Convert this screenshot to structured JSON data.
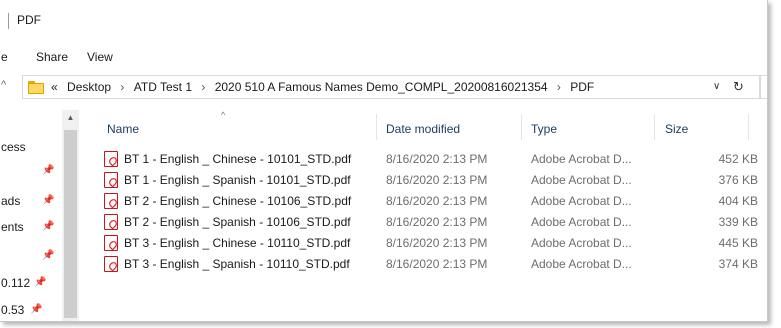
{
  "window": {
    "title": "PDF"
  },
  "ribbon": {
    "tabs": [
      "e",
      "Share",
      "View"
    ]
  },
  "address": {
    "crumbs": [
      "«",
      "Desktop",
      "ATD Test 1",
      "2020 510 A Famous Names Demo_COMPL_20200816021354",
      "PDF"
    ],
    "dropdown": "∨",
    "refresh": "↻"
  },
  "nav": {
    "items": [
      {
        "label": "cess",
        "pinned": false
      },
      {
        "label": "",
        "pinned": true
      },
      {
        "label": "ads",
        "pinned": true
      },
      {
        "label": "ents",
        "pinned": true
      },
      {
        "label": "",
        "pinned": true
      },
      {
        "label": "0.112",
        "pinned": true
      },
      {
        "label": "0.53",
        "pinned": true
      }
    ]
  },
  "columns": {
    "name": "Name",
    "date": "Date modified",
    "type": "Type",
    "size": "Size"
  },
  "files": [
    {
      "name": "BT 1 - English _ Chinese - 10101_STD.pdf",
      "date": "8/16/2020 2:13 PM",
      "type": "Adobe Acrobat D...",
      "size": "452 KB"
    },
    {
      "name": "BT 1 - English _ Spanish - 10101_STD.pdf",
      "date": "8/16/2020 2:13 PM",
      "type": "Adobe Acrobat D...",
      "size": "376 KB"
    },
    {
      "name": "BT 2 - English _ Chinese - 10106_STD.pdf",
      "date": "8/16/2020 2:13 PM",
      "type": "Adobe Acrobat D...",
      "size": "404 KB"
    },
    {
      "name": "BT 2 - English _ Spanish - 10106_STD.pdf",
      "date": "8/16/2020 2:13 PM",
      "type": "Adobe Acrobat D...",
      "size": "339 KB"
    },
    {
      "name": "BT 3 - English _ Chinese - 10110_STD.pdf",
      "date": "8/16/2020 2:13 PM",
      "type": "Adobe Acrobat D...",
      "size": "445 KB"
    },
    {
      "name": "BT 3 - English _ Spanish - 10110_STD.pdf",
      "date": "8/16/2020 2:13 PM",
      "type": "Adobe Acrobat D...",
      "size": "374 KB"
    }
  ],
  "colors": {
    "accent_pdf": "#d71f26",
    "header_text": "#1c3e63",
    "folder": "#ffd766"
  }
}
